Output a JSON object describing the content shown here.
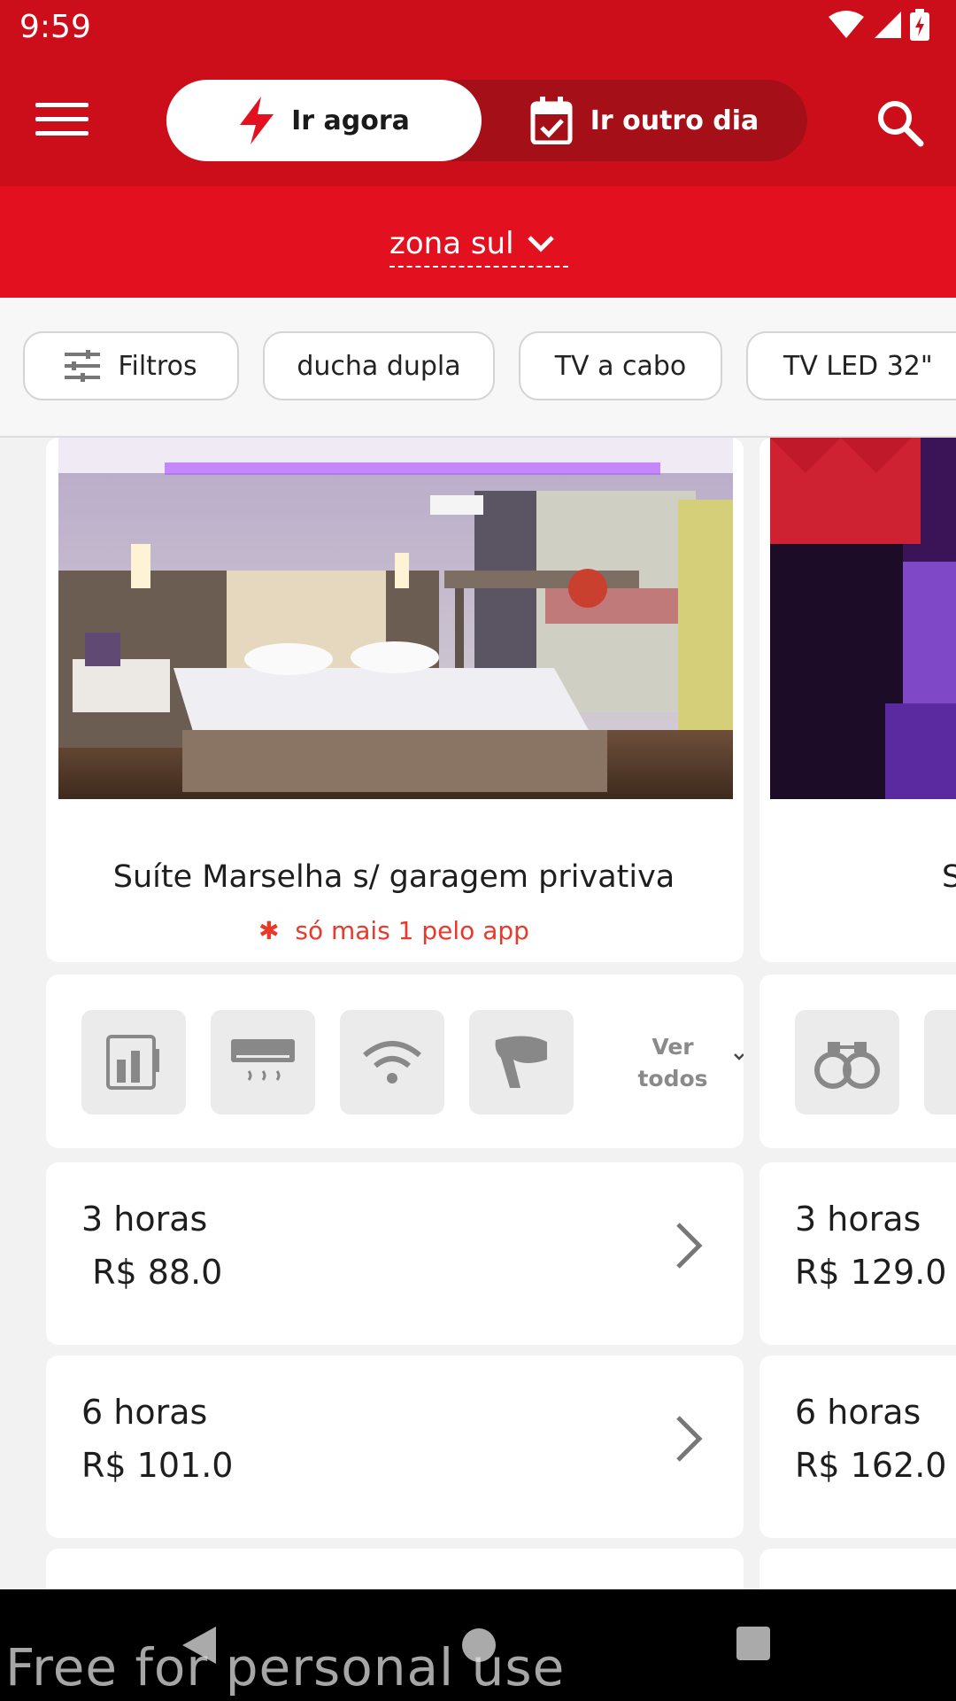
{
  "status_bar": {
    "time": "9:59"
  },
  "header": {
    "menu_icon": "hamburger-menu-icon",
    "tabs": [
      {
        "label": "Ir agora",
        "icon": "lightning-icon",
        "active": true
      },
      {
        "label": "Ir outro dia",
        "icon": "calendar-check-icon",
        "active": false
      }
    ],
    "search_icon": "search-icon",
    "zone": {
      "label": "zona sul",
      "icon": "chevron-down-icon"
    }
  },
  "filters": [
    {
      "label": "Filtros",
      "icon": "sliders-icon"
    },
    {
      "label": "ducha dupla"
    },
    {
      "label": "TV a cabo"
    },
    {
      "label": "TV LED 32\""
    }
  ],
  "cards": [
    {
      "title": "Suíte Marselha s/ garagem privativa",
      "note": "só mais 1 pelo app",
      "amenities": [
        "minibar-icon",
        "air-conditioner-icon",
        "wifi-icon",
        "hair-dryer-icon"
      ],
      "see_all": "Ver todos",
      "prices": [
        {
          "duration": "3 horas",
          "price": " R$ 88.0"
        },
        {
          "duration": "6 horas",
          "price": "R$ 101.0"
        }
      ]
    },
    {
      "title_partial": "S",
      "amenities": [
        "handcuffs-icon"
      ],
      "prices": [
        {
          "duration": "3 horas",
          "price": "R$ 129.0"
        },
        {
          "duration": "6 horas",
          "price": "R$ 162.0"
        }
      ]
    }
  ],
  "colors": {
    "brand_red": "#cc0e1b",
    "accent_red": "#e3101f",
    "note_red": "#e8392b"
  },
  "watermark": "Free for personal use"
}
